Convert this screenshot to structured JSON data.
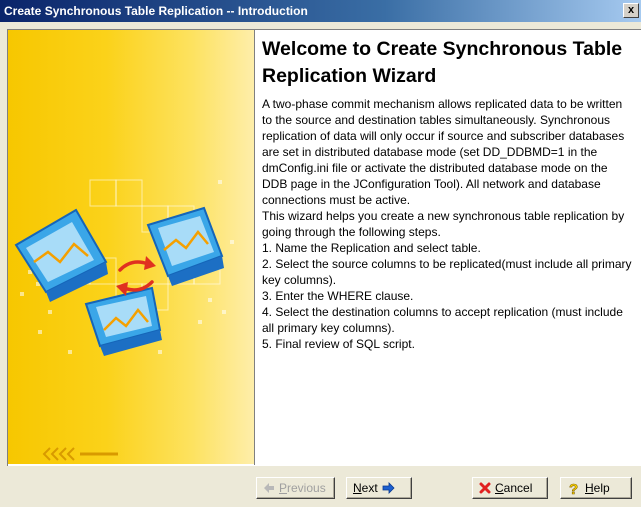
{
  "window": {
    "title": "Create Synchronous Table Replication -- Introduction",
    "close_glyph": "x"
  },
  "wizard": {
    "heading": "Welcome to Create Synchronous Table Replication Wizard",
    "intro": "A two-phase commit mechanism allows replicated data to be written to the source and destination tables simultaneously. Synchronous replication of data will only occur if source and subscriber databases are set in distributed database mode (set DD_DDBMD=1 in the dmConfig.ini file or activate the distributed database mode on the DDB page in the JConfiguration Tool). All network and database connections must be active.\nThis wizard helps you create a new synchronous table replication by going through the following steps.",
    "steps": [
      "1. Name the Replication and select table.",
      "2. Select the source columns to be replicated(must include all primary key columns).",
      "3. Enter the WHERE clause.",
      "4. Select the destination columns to accept replication (must include all primary key columns).",
      "5. Final review of SQL script."
    ]
  },
  "buttons": {
    "previous": {
      "mnemonic": "P",
      "rest": "revious",
      "enabled": false
    },
    "next": {
      "mnemonic": "N",
      "rest": "ext",
      "enabled": true
    },
    "cancel": {
      "mnemonic": "C",
      "rest": "ancel",
      "enabled": true
    },
    "help": {
      "mnemonic": "H",
      "rest": "elp",
      "enabled": true
    }
  },
  "colors": {
    "panel_yellow": "#f7c700",
    "cancel_icon": "#e02020",
    "help_icon": "#ffd800",
    "arrow_blue": "#1c5fd0"
  }
}
